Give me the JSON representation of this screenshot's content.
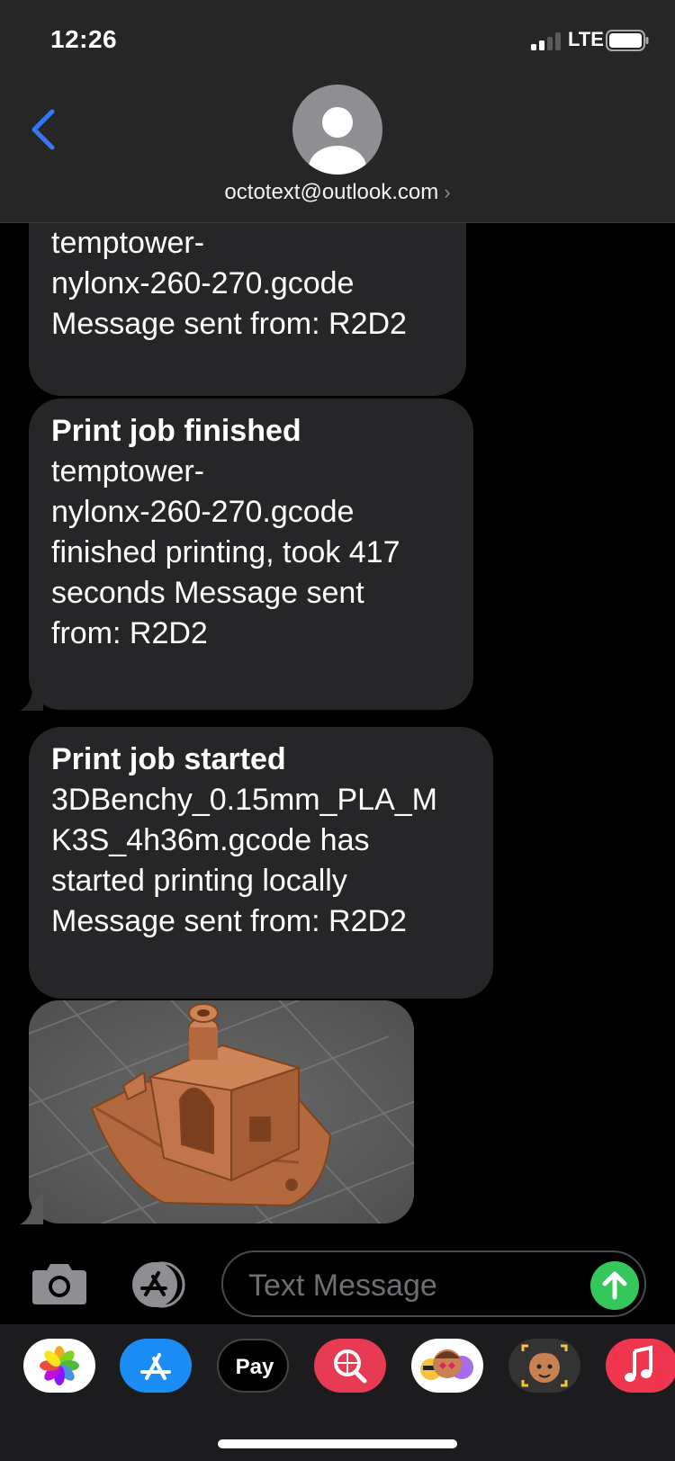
{
  "status_bar": {
    "time": "12:26",
    "network": "LTE",
    "signal_bars": 2
  },
  "header": {
    "contact": "octotext@outlook.com",
    "back_icon": "chevron-left-icon",
    "avatar_icon": "person-silhouette-icon",
    "accent_color": "#3478f6"
  },
  "messages": [
    {
      "title": "",
      "body": "temptower-\nnylonx-260-270.gcode\nMessage sent from: R2D2"
    },
    {
      "title": "Print job finished",
      "body": "temptower-\nnylonx-260-270.gcode\nfinished printing, took 417\nseconds Message sent\nfrom: R2D2"
    },
    {
      "title": "Print job started",
      "body": "3DBenchy_0.15mm_PLA_M\nK3S_4h36m.gcode has\nstarted printing locally\nMessage sent from: R2D2"
    }
  ],
  "image_message": {
    "subject": "3D Benchy boat render on grid",
    "model_color": "#b4683d"
  },
  "input": {
    "placeholder": "Text Message",
    "send_color": "#34c759"
  },
  "app_drawer": [
    {
      "name": "photos-app-icon"
    },
    {
      "name": "app-store-icon"
    },
    {
      "name": "apple-pay-icon",
      "label": "Pay"
    },
    {
      "name": "web-search-icon"
    },
    {
      "name": "memoji-stickers-icon"
    },
    {
      "name": "memoji-icon"
    },
    {
      "name": "music-icon"
    }
  ]
}
